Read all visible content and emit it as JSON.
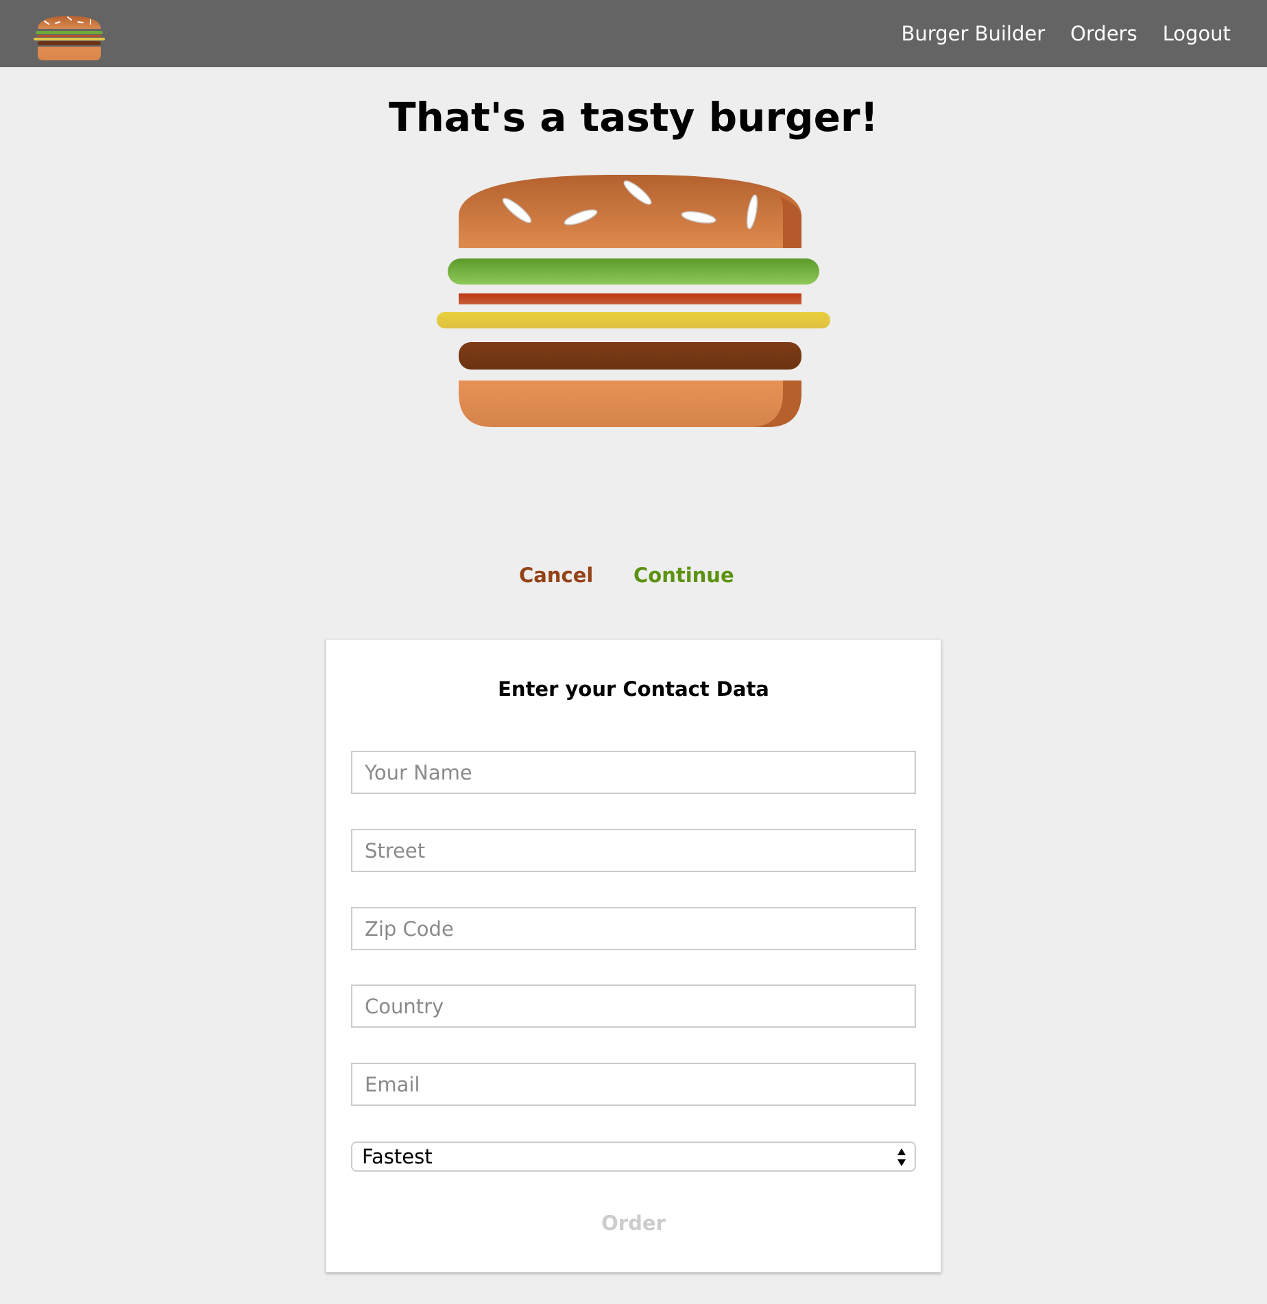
{
  "toolbar": {
    "nav": [
      "Burger Builder",
      "Orders",
      "Logout"
    ],
    "background": "#646464"
  },
  "summary": {
    "title": "That's a tasty burger!",
    "ingredients": [
      "bread-top",
      "salad",
      "bacon",
      "cheese",
      "meat",
      "bread-bottom"
    ],
    "cancel_label": "Cancel",
    "continue_label": "Continue",
    "cancel_color": "#944317",
    "continue_color": "#5c9210"
  },
  "contact": {
    "title": "Enter your Contact Data",
    "fields": [
      {
        "placeholder": "Your Name",
        "value": ""
      },
      {
        "placeholder": "Street",
        "value": ""
      },
      {
        "placeholder": "Zip Code",
        "value": ""
      },
      {
        "placeholder": "Country",
        "value": ""
      },
      {
        "placeholder": "Email",
        "value": ""
      }
    ],
    "delivery_method": "Fastest",
    "order_label": "Order"
  }
}
